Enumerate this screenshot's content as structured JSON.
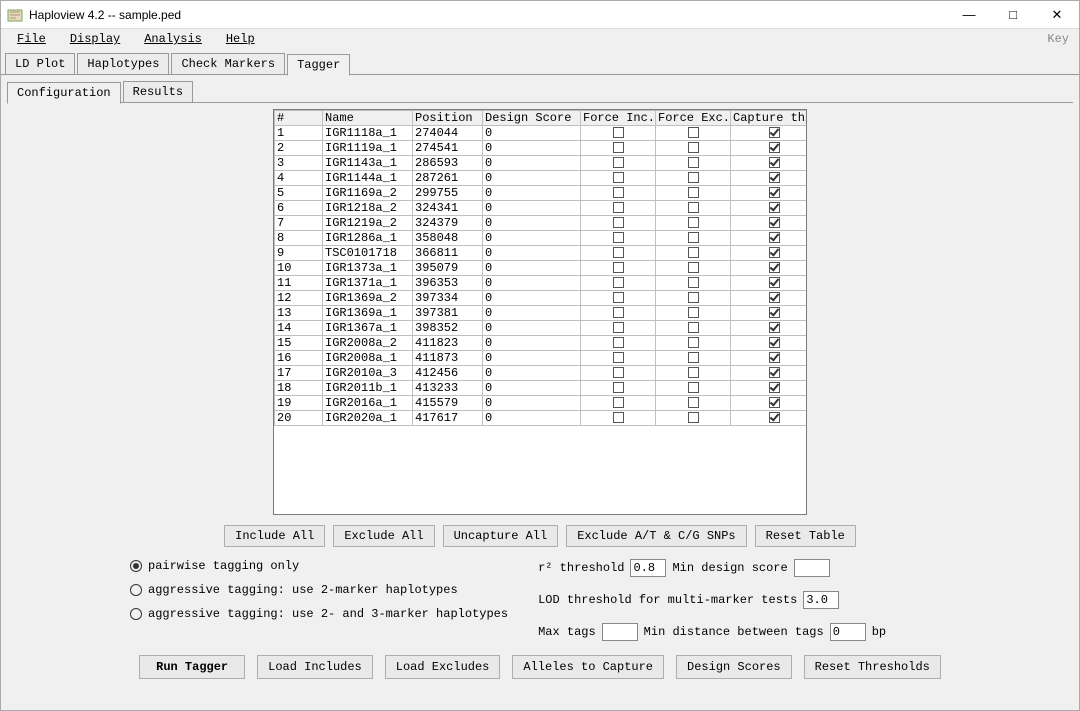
{
  "window": {
    "title": "Haploview 4.2 -- sample.ped",
    "min": "—",
    "max": "□",
    "close": "✕"
  },
  "menu": {
    "file": "File",
    "display": "Display",
    "analysis": "Analysis",
    "help": "Help",
    "key": "Key"
  },
  "tabs": {
    "ld": "LD Plot",
    "haplo": "Haplotypes",
    "check": "Check Markers",
    "tagger": "Tagger"
  },
  "subtabs": {
    "config": "Configuration",
    "results": "Results"
  },
  "table": {
    "headers": {
      "idx": "#",
      "name": "Name",
      "position": "Position",
      "design": "Design Score",
      "finc": "Force Inc...",
      "fexc": "Force Exc...",
      "cap": "Capture this ..."
    },
    "rows": [
      {
        "idx": "1",
        "name": "IGR1118a_1",
        "position": "274044",
        "design": "0"
      },
      {
        "idx": "2",
        "name": "IGR1119a_1",
        "position": "274541",
        "design": "0"
      },
      {
        "idx": "3",
        "name": "IGR1143a_1",
        "position": "286593",
        "design": "0"
      },
      {
        "idx": "4",
        "name": "IGR1144a_1",
        "position": "287261",
        "design": "0"
      },
      {
        "idx": "5",
        "name": "IGR1169a_2",
        "position": "299755",
        "design": "0"
      },
      {
        "idx": "6",
        "name": "IGR1218a_2",
        "position": "324341",
        "design": "0"
      },
      {
        "idx": "7",
        "name": "IGR1219a_2",
        "position": "324379",
        "design": "0"
      },
      {
        "idx": "8",
        "name": "IGR1286a_1",
        "position": "358048",
        "design": "0"
      },
      {
        "idx": "9",
        "name": "TSC0101718",
        "position": "366811",
        "design": "0"
      },
      {
        "idx": "10",
        "name": "IGR1373a_1",
        "position": "395079",
        "design": "0"
      },
      {
        "idx": "11",
        "name": "IGR1371a_1",
        "position": "396353",
        "design": "0"
      },
      {
        "idx": "12",
        "name": "IGR1369a_2",
        "position": "397334",
        "design": "0"
      },
      {
        "idx": "13",
        "name": "IGR1369a_1",
        "position": "397381",
        "design": "0"
      },
      {
        "idx": "14",
        "name": "IGR1367a_1",
        "position": "398352",
        "design": "0"
      },
      {
        "idx": "15",
        "name": "IGR2008a_2",
        "position": "411823",
        "design": "0"
      },
      {
        "idx": "16",
        "name": "IGR2008a_1",
        "position": "411873",
        "design": "0"
      },
      {
        "idx": "17",
        "name": "IGR2010a_3",
        "position": "412456",
        "design": "0"
      },
      {
        "idx": "18",
        "name": "IGR2011b_1",
        "position": "413233",
        "design": "0"
      },
      {
        "idx": "19",
        "name": "IGR2016a_1",
        "position": "415579",
        "design": "0"
      },
      {
        "idx": "20",
        "name": "IGR2020a_1",
        "position": "417617",
        "design": "0"
      }
    ]
  },
  "midButtons": {
    "include": "Include All",
    "exclude": "Exclude All",
    "uncapture": "Uncapture All",
    "excludeATCG": "Exclude A/T & C/G SNPs",
    "reset": "Reset Table"
  },
  "radios": {
    "pairwise": "pairwise tagging only",
    "agg2": "aggressive tagging: use 2-marker haplotypes",
    "agg23": "aggressive tagging: use 2- and 3-marker haplotypes"
  },
  "thresh": {
    "r2": "r² threshold",
    "r2val": "0.8",
    "mindesign": "Min design score",
    "mindesignval": "",
    "lod": "LOD threshold for multi-marker tests",
    "lodval": "3.0",
    "maxtags": "Max tags",
    "maxtagsval": "",
    "mindist": "Min distance between tags",
    "mindistval": "0",
    "bp": "bp"
  },
  "bottomButtons": {
    "run": "Run Tagger",
    "loadinc": "Load Includes",
    "loadexc": "Load Excludes",
    "alleles": "Alleles to Capture",
    "scores": "Design Scores",
    "resetthr": "Reset Thresholds"
  }
}
